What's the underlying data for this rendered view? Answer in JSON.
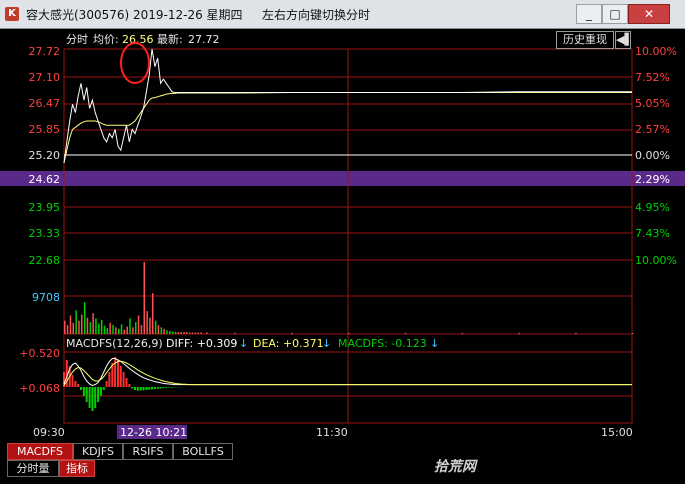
{
  "window": {
    "title": "容大感光(300576) 2019-12-26 星期四",
    "hint": "左右方向键切换分时",
    "buttons": {
      "minimize": "_",
      "maximize": "□",
      "close": "✕"
    }
  },
  "header": {
    "label": "分时",
    "avg_label": "均价:",
    "avg_value": "26.56",
    "latest_label": "最新:",
    "latest_value": "27.72",
    "history_button": "历史重现",
    "history_arrow": "◀▌"
  },
  "price_axis_left": [
    "27.72",
    "27.10",
    "26.47",
    "25.85",
    "25.20",
    "24.62",
    "23.95",
    "23.33",
    "22.68"
  ],
  "price_axis_right": [
    "10.00%",
    "7.52%",
    "5.05%",
    "2.57%",
    "0.00%",
    "2.29%",
    "4.95%",
    "7.43%",
    "10.00%"
  ],
  "volume_label": "9708",
  "macd": {
    "title": "MACDFS(12,26,9)",
    "diff_label": "DIFF: +0.309",
    "dea_label": "DEA: +0.371",
    "macdfs_label": "MACDFS: -0.123",
    "arrow": "↓",
    "axis": [
      "+0.520",
      "+0.068"
    ]
  },
  "time_axis": {
    "start": "09:30",
    "cursor": "12-26 10:21",
    "mid": "11:30",
    "end": "15:00"
  },
  "tabs_row1": [
    "MACDFS",
    "KDJFS",
    "RSIFS",
    "BOLLFS"
  ],
  "tabs_row2": [
    "分时量",
    "指标"
  ],
  "watermark": "拾荒网",
  "colors": {
    "up": "#ff3030",
    "down": "#00d000",
    "grid": "#9a1515",
    "price_line": "#ffffff",
    "avg_line": "#ffff80",
    "highlight_bar": "#5a2a8a"
  },
  "chart_data": {
    "type": "line",
    "prev_close": 25.2,
    "ylim": [
      22.68,
      27.72
    ],
    "time_pct": [
      0,
      0.5,
      1,
      1.5,
      2,
      2.5,
      3,
      3.5,
      4,
      4.5,
      5,
      5.5,
      6,
      6.5,
      7,
      7.5,
      8,
      8.5,
      9,
      9.5,
      10,
      10.5,
      11,
      11.5,
      12,
      12.5,
      13,
      13.5,
      14,
      14.5,
      15,
      15.5,
      16,
      16.5,
      17,
      17.5,
      18,
      18.5,
      19,
      19.5,
      20,
      20.5,
      21,
      21.5,
      22,
      22.5,
      23,
      23.5,
      24,
      25,
      30,
      40,
      50,
      60,
      70,
      80,
      90,
      100
    ],
    "price": [
      25.0,
      25.5,
      26.0,
      26.4,
      26.2,
      26.6,
      26.9,
      26.5,
      26.8,
      26.3,
      26.5,
      26.2,
      26.0,
      25.8,
      25.6,
      25.5,
      25.7,
      25.6,
      25.8,
      25.4,
      25.3,
      25.6,
      25.9,
      25.5,
      25.8,
      25.7,
      25.9,
      26.1,
      26.3,
      26.7,
      27.1,
      27.72,
      27.3,
      27.5,
      26.9,
      27.0,
      26.9,
      26.8,
      26.7,
      26.68,
      26.68,
      26.68,
      26.68,
      26.68,
      26.68,
      26.68,
      26.68,
      26.68,
      26.68,
      26.68,
      26.68,
      26.68,
      26.68,
      26.68,
      26.68,
      26.7,
      26.7,
      26.7
    ],
    "avg": [
      25.0,
      25.3,
      25.6,
      25.8,
      25.85,
      25.9,
      25.95,
      25.98,
      26.0,
      26.0,
      26.0,
      26.0,
      25.98,
      25.95,
      25.92,
      25.9,
      25.9,
      25.9,
      25.9,
      25.9,
      25.9,
      25.9,
      25.9,
      25.9,
      25.95,
      26.0,
      26.1,
      26.2,
      26.3,
      26.4,
      26.5,
      26.55,
      26.56,
      26.58,
      26.6,
      26.62,
      26.64,
      26.65,
      26.66,
      26.66,
      26.67,
      26.67,
      26.67,
      26.67,
      26.67,
      26.67,
      26.67,
      26.67,
      26.67,
      26.67,
      26.67,
      26.68,
      26.68,
      26.68,
      26.68,
      26.68,
      26.68,
      26.68
    ],
    "volume_max": 9708,
    "volume": [
      1800,
      1200,
      2500,
      1500,
      3200,
      1800,
      2600,
      4300,
      2200,
      1600,
      2800,
      2100,
      1400,
      1900,
      1100,
      800,
      1500,
      1200,
      900,
      700,
      1300,
      600,
      1000,
      2100,
      900,
      1600,
      2500,
      1200,
      9708,
      3100,
      2200,
      5500,
      1800,
      1200,
      900,
      700,
      500,
      400,
      300,
      300,
      250,
      250,
      250,
      250,
      200,
      200,
      200,
      200,
      200,
      200,
      150,
      150,
      150,
      150,
      150,
      150,
      150,
      150
    ],
    "macd_hist": [
      0.5,
      0.9,
      0.7,
      0.4,
      0.2,
      0.1,
      -0.1,
      -0.3,
      -0.5,
      -0.7,
      -0.8,
      -0.7,
      -0.5,
      -0.3,
      -0.1,
      0.2,
      0.5,
      0.8,
      1.0,
      0.9,
      0.7,
      0.5,
      0.3,
      0.1,
      -0.05,
      -0.1,
      -0.12,
      -0.12,
      -0.11,
      -0.1,
      -0.09,
      -0.08,
      -0.07,
      -0.06,
      -0.05,
      -0.04,
      -0.03,
      -0.02,
      -0.02,
      -0.01,
      -0.01,
      -0.01,
      0,
      0,
      0,
      0,
      0,
      0,
      0,
      0,
      0,
      0,
      0,
      0,
      0,
      0,
      0,
      0
    ],
    "diff": [
      0.1,
      0.35,
      0.6,
      0.75,
      0.8,
      0.7,
      0.55,
      0.35,
      0.2,
      0.1,
      0.05,
      0.08,
      0.15,
      0.3,
      0.5,
      0.7,
      0.85,
      0.95,
      0.95,
      0.9,
      0.85,
      0.78,
      0.7,
      0.62,
      0.55,
      0.48,
      0.42,
      0.36,
      0.31,
      0.27,
      0.24,
      0.21,
      0.18,
      0.16,
      0.14,
      0.12,
      0.11,
      0.1,
      0.09,
      0.08,
      0.08,
      0.08,
      0.08,
      0.08,
      0.08,
      0.08,
      0.08,
      0.08,
      0.08,
      0.08,
      0.08,
      0.08,
      0.08,
      0.08,
      0.08,
      0.08,
      0.08,
      0.08
    ],
    "dea": [
      0.05,
      0.2,
      0.35,
      0.5,
      0.6,
      0.65,
      0.63,
      0.55,
      0.45,
      0.35,
      0.25,
      0.2,
      0.2,
      0.25,
      0.35,
      0.48,
      0.6,
      0.72,
      0.8,
      0.85,
      0.86,
      0.84,
      0.8,
      0.75,
      0.69,
      0.63,
      0.57,
      0.51,
      0.46,
      0.41,
      0.37,
      0.33,
      0.29,
      0.26,
      0.23,
      0.2,
      0.18,
      0.16,
      0.14,
      0.12,
      0.11,
      0.1,
      0.09,
      0.09,
      0.08,
      0.08,
      0.08,
      0.08,
      0.08,
      0.08,
      0.08,
      0.08,
      0.08,
      0.08,
      0.08,
      0.08,
      0.08,
      0.08
    ]
  }
}
